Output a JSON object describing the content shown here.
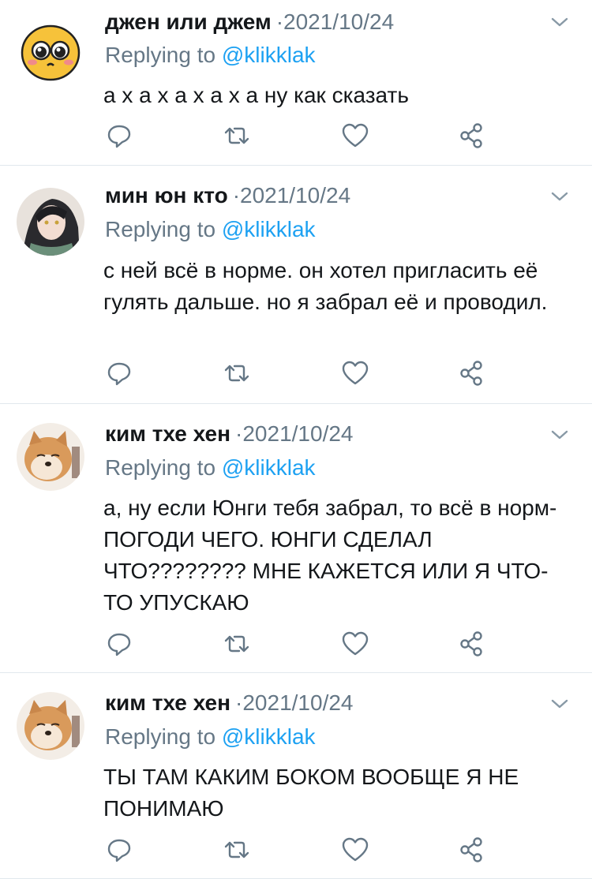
{
  "tweets": [
    {
      "name": "джен или джем",
      "separator": "·",
      "date": "2021/10/24",
      "reply_prefix": "Replying to",
      "reply_handle": "@klikklak",
      "body": "а х а х а х а х а ну как сказать",
      "avatar": "emoji-face-avatar"
    },
    {
      "name": "мин юн кто",
      "separator": "·",
      "date": "2021/10/24",
      "reply_prefix": "Replying to",
      "reply_handle": "@klikklak",
      "body": "с ней всё в норме. он хотел пригласить её гулять дальше. но я забрал её и проводил.",
      "avatar": "anime-character-avatar"
    },
    {
      "name": "ким тхе хен",
      "separator": "·",
      "date": "2021/10/24",
      "reply_prefix": "Replying to",
      "reply_handle": "@klikklak",
      "body": "а, ну если Юнги тебя забрал, то всё в норм- ПОГОДИ ЧЕГО. ЮНГИ СДЕЛАЛ ЧТО???????? МНЕ КАЖЕТСЯ ИЛИ Я ЧТО-ТО УПУСКАЮ",
      "avatar": "shiba-dog-avatar"
    },
    {
      "name": "ким тхе хен",
      "separator": "·",
      "date": "2021/10/24",
      "reply_prefix": "Replying to",
      "reply_handle": "@klikklak",
      "body": "ТЫ ТАМ КАКИМ БОКОМ ВООБЩЕ Я НЕ ПОНИМАЮ",
      "avatar": "shiba-dog-avatar"
    }
  ],
  "icons": {
    "reply": "reply-icon",
    "retweet": "retweet-icon",
    "like": "like-icon",
    "share": "share-icon",
    "menu": "chevron-down-icon"
  },
  "colors": {
    "text": "#14171a",
    "secondary": "#657786",
    "link": "#1da1f2",
    "divider": "#e1e8ed"
  }
}
